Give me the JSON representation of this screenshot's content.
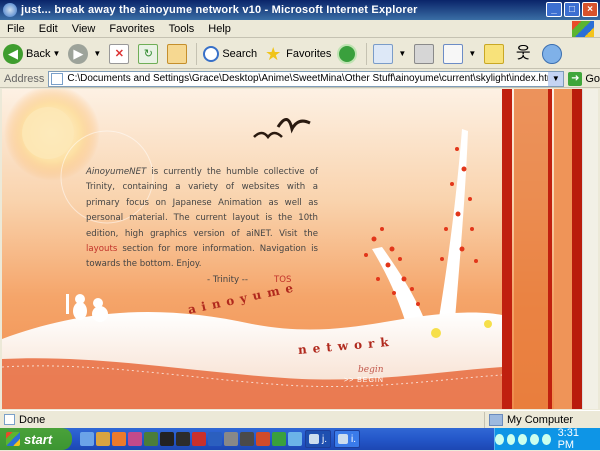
{
  "window": {
    "title": "just...        break away        the ainoyume network        v10 - Microsoft Internet Explorer",
    "controls": {
      "minimize": "_",
      "maximize": "□",
      "close": "×"
    }
  },
  "menu": [
    "File",
    "Edit",
    "View",
    "Favorites",
    "Tools",
    "Help"
  ],
  "toolbar": {
    "back_label": "Back",
    "search_label": "Search",
    "favorites_label": "Favorites"
  },
  "address": {
    "label": "Address",
    "url": "C:\\Documents and Settings\\Grace\\Desktop\\Anime\\SweetMina\\Other Stuff\\ainoyume\\current\\skylight\\index.html",
    "go_label": "Go"
  },
  "page": {
    "intro_em": "AinoyumeNET",
    "intro_1": " is currently the humble collective of Trinity, containing a variety of websites with a primary focus on Japanese Animation as well as personal material. The current layout is the 10th edition, high graphics version of aiNET. Visit the ",
    "intro_link": "layouts",
    "intro_2": " section for more information. Navigation is towards the bottom. Enjoy.",
    "signature": "- Trinity        --",
    "tos_link": "TOS",
    "title_line1": "ainoyume",
    "title_line2": "network",
    "begin_script": "begin",
    "begin_link": ">> BEGIN"
  },
  "status": {
    "text": "Done",
    "zone": "My Computer"
  },
  "taskbar": {
    "start_label": "start",
    "tasks": [
      "j.",
      "i."
    ],
    "clock": "3:31 PM"
  },
  "colors": {
    "accent_red": "#b0291d",
    "link_red": "#c2322a"
  }
}
